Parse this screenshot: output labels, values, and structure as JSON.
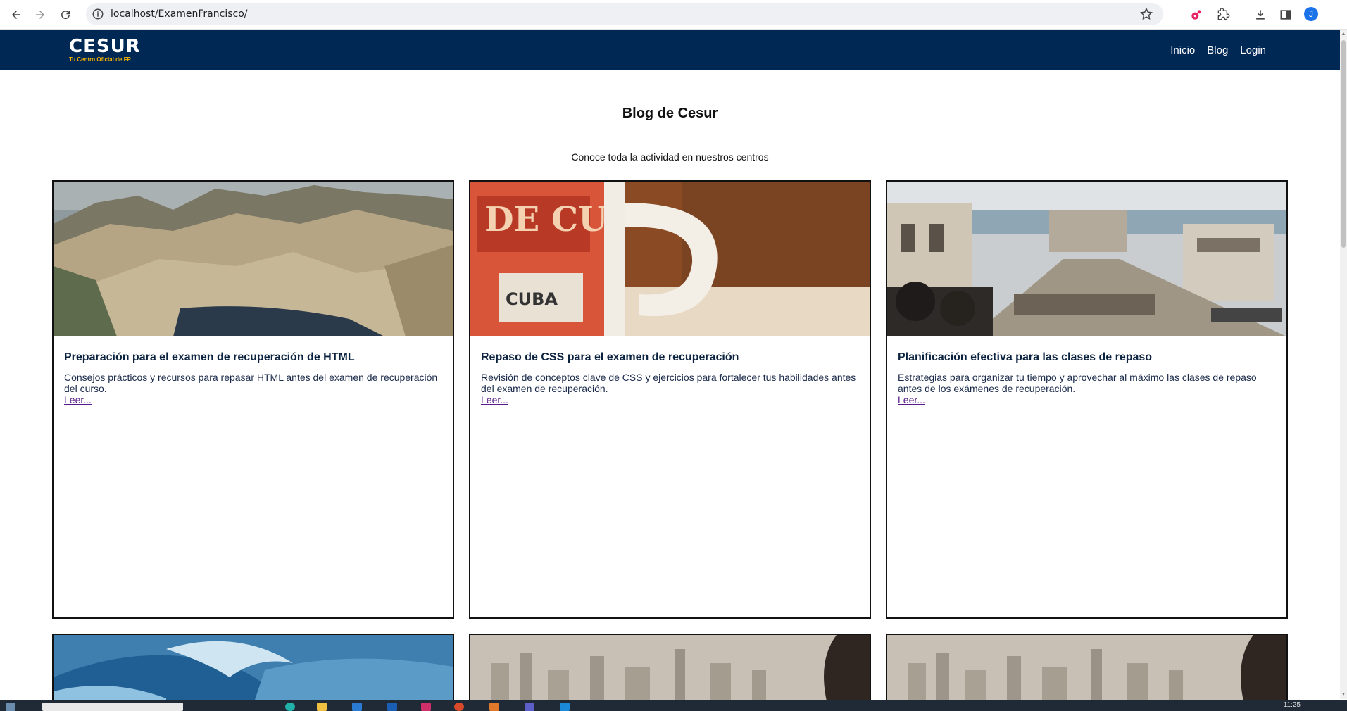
{
  "browser": {
    "url": "localhost/ExamenFrancisco/",
    "profile_initial": "J"
  },
  "site": {
    "logo_name": "CESUR",
    "logo_tagline": "Tu Centro Oficial de FP",
    "nav": [
      "Inicio",
      "Blog",
      "Login"
    ]
  },
  "page": {
    "title": "Blog de Cesur",
    "subtitle": "Conoce toda la actividad en nuestros centros"
  },
  "cards": [
    {
      "image": "mountain-coast-photo",
      "title": "Preparación para el examen de recuperación de HTML",
      "description": "Consejos prácticos y recursos para repasar HTML antes del examen de recuperación del curso.",
      "link": "Leer..."
    },
    {
      "image": "coffee-mug-photo",
      "title": "Repaso de CSS para el examen de recuperación",
      "description": "Revisión de conceptos clave de CSS y ejercicios para fortalecer tus habilidades antes del examen de recuperación.",
      "link": "Leer..."
    },
    {
      "image": "boardwalk-crowd-photo",
      "title": "Planificación efectiva para las clases de repaso",
      "description": "Estrategias para organizar tu tiempo y aprovechar al máximo las clases de repaso antes de los exámenes de recuperación.",
      "link": "Leer..."
    }
  ],
  "bottom_cards": [
    "ocean-wave-photo",
    "city-skyline-photo",
    "city-skyline-photo"
  ],
  "taskbar": {
    "clock": "11:25"
  },
  "colors": {
    "header_bg": "#002855",
    "title_text": "#0c2340",
    "visited_link": "#551a8b"
  }
}
